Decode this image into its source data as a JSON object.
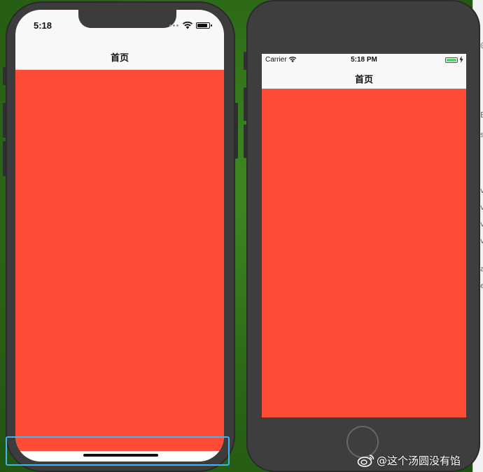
{
  "simulator_left": {
    "device": "iPhone X",
    "status_time": "5:18",
    "nav_title": "首页",
    "content_color": "#fe4c37",
    "home_indicator_highlight_color": "#3fb6f0",
    "icons": [
      "signal-dots-icon",
      "wifi-icon",
      "battery-icon"
    ]
  },
  "simulator_right": {
    "device": "iPhone 8",
    "carrier": "Carrier",
    "status_time": "5:18 PM",
    "nav_title": "首页",
    "content_color": "#fe4c37",
    "battery_color": "#4cd964",
    "icons": [
      "wifi-icon",
      "battery-icon",
      "charging-bolt-icon",
      "home-button"
    ]
  },
  "background_window": {
    "visible_chars": [
      "@",
      "E",
      "s",
      "v",
      "v",
      "v",
      "v",
      "a",
      "e"
    ]
  },
  "watermark": {
    "text": "@这个汤圆没有馅",
    "icon": "weibo-icon"
  }
}
